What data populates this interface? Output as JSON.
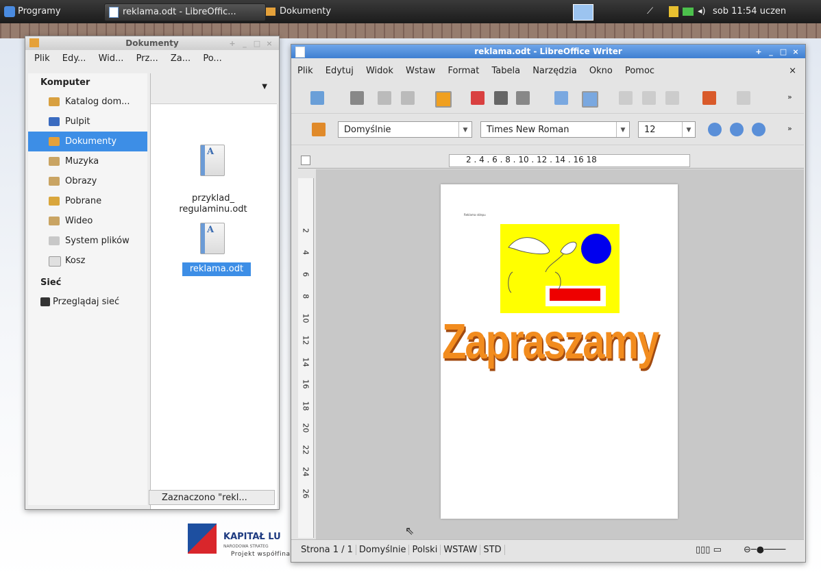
{
  "taskbar": {
    "start": "Programy",
    "task1": "reklama.odt - LibreOffic...",
    "task2": "Dokumenty",
    "clock": "sob 11:54",
    "user": "uczen"
  },
  "file_manager": {
    "title": "Dokumenty",
    "menu": [
      "Plik",
      "Edy...",
      "Wid...",
      "Prz...",
      "Za...",
      "Po..."
    ],
    "section_computer": "Komputer",
    "places": [
      "Katalog dom...",
      "Pulpit",
      "Dokumenty",
      "Muzyka",
      "Obrazy",
      "Pobrane",
      "Wideo",
      "System plików",
      "Kosz"
    ],
    "selected_place": "Dokumenty",
    "section_network": "Sieć",
    "network_item": "Przeglądaj sieć",
    "file1_line1": "przyklad_",
    "file1_line2": "regulaminu.odt",
    "file2": "reklama.odt",
    "status": "Zaznaczono \"rekl..."
  },
  "writer": {
    "title": "reklama.odt - LibreOffice Writer",
    "menu": [
      "Plik",
      "Edytuj",
      "Widok",
      "Wstaw",
      "Format",
      "Tabela",
      "Narzędzia",
      "Okno",
      "Pomoc"
    ],
    "style": "Domyślnie",
    "font": "Times New Roman",
    "size": "12",
    "ruler": "2 . 4 . 6 . 8 . 10 . 12 . 14 . 16 18",
    "vruler": [
      "2",
      "4",
      "6",
      "8",
      "10",
      "12",
      "14",
      "16",
      "18",
      "20",
      "22",
      "24",
      "26"
    ],
    "page_small_text": "Reklama sklepu",
    "wordart": "Zapraszamy",
    "status": [
      "Strona 1 / 1",
      "Domyślnie",
      "Polski",
      "WSTAW",
      "STD"
    ]
  },
  "wallpaper": {
    "logo_text": "KAPITAŁ LU",
    "logo_sub": "NARODOWA STRATEG",
    "footer": "Projekt współfinansowany ze środków Unii Europejskiej w ramach Europejskiego Funduszu Społecznego"
  },
  "colors": {
    "selection": "#3d8ee6",
    "writer_title": "#3f7fd1",
    "image_yellow": "#ffff00",
    "circle_blue": "#0000ee",
    "rect_red": "#ee0000",
    "wordart_orange": "#f28c1e"
  }
}
